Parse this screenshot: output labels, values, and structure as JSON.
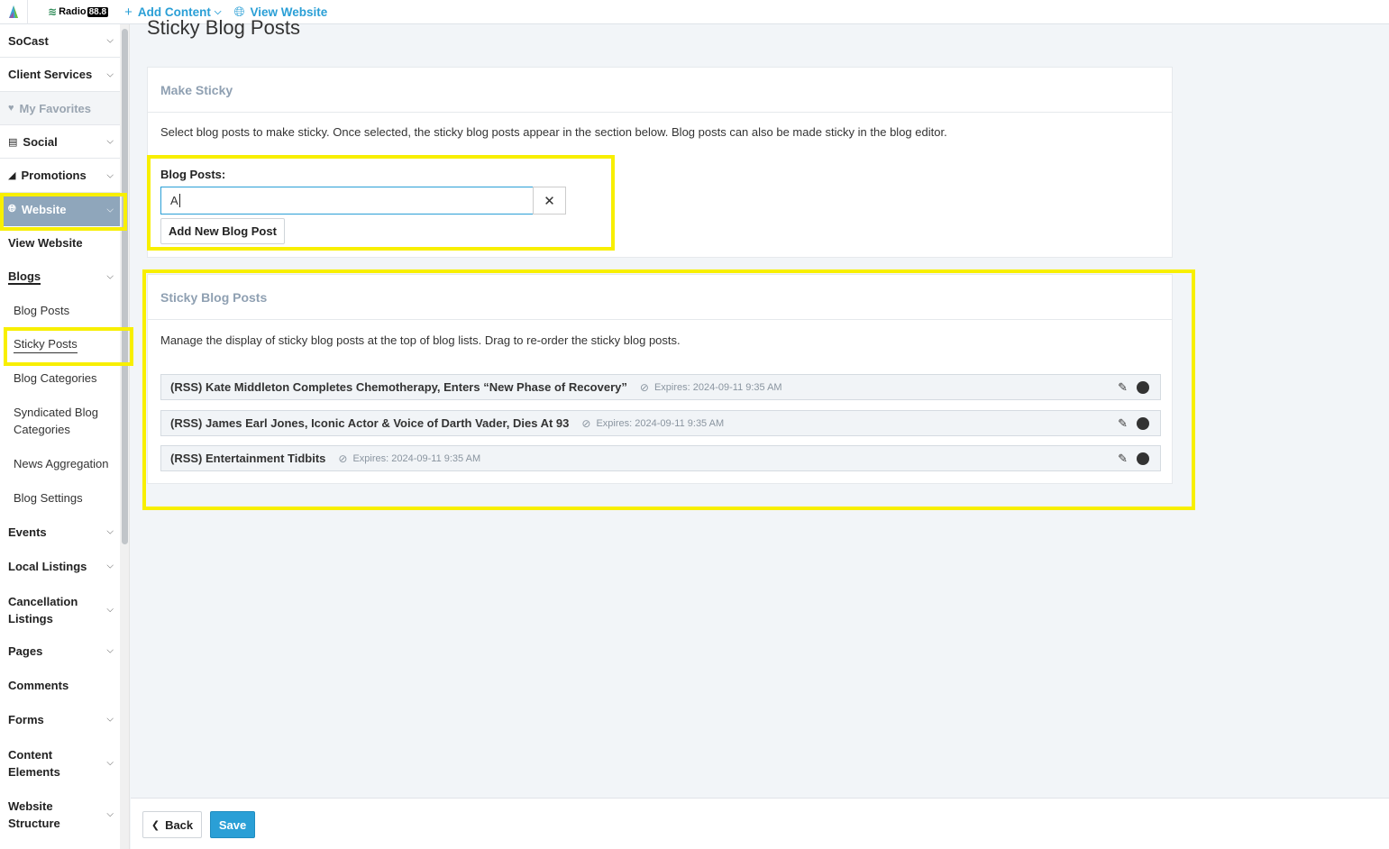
{
  "topbar": {
    "station_name": "Radio",
    "station_number": "88.8",
    "add_content": "Add Content",
    "view_website": "View Website"
  },
  "sidebar": {
    "socast": "SoCast",
    "client_services": "Client Services",
    "my_favorites": "My Favorites",
    "social": "Social",
    "promotions": "Promotions",
    "website": "Website",
    "view_website": "View Website",
    "blogs": "Blogs",
    "blog_posts": "Blog Posts",
    "sticky_posts": "Sticky Posts",
    "blog_categories": "Blog Categories",
    "syndicated_1": "Syndicated Blog",
    "syndicated_2": "Categories",
    "news_aggregation": "News Aggregation",
    "blog_settings": "Blog Settings",
    "events": "Events",
    "local_listings": "Local Listings",
    "cancellation_1": "Cancellation",
    "cancellation_2": "Listings",
    "pages": "Pages",
    "comments": "Comments",
    "forms": "Forms",
    "content_elements_1": "Content",
    "content_elements_2": "Elements",
    "website_structure_1": "Website",
    "website_structure_2": "Structure"
  },
  "page": {
    "title": "Sticky Blog Posts"
  },
  "make_sticky": {
    "heading": "Make Sticky",
    "description": "Select blog posts to make sticky. Once selected, the sticky blog posts appear in the section below. Blog posts can also be made sticky in the blog editor.",
    "blog_posts_label": "Blog Posts:",
    "search_value": "A",
    "add_new": "Add New Blog Post"
  },
  "sticky_section": {
    "heading": "Sticky Blog Posts",
    "description": "Manage the display of sticky blog posts at the top of blog lists. Drag to re-order the sticky blog posts.",
    "items": [
      {
        "title": "(RSS) Kate Middleton Completes Chemotherapy, Enters “New Phase of Recovery”",
        "expires": "Expires: 2024-09-11 9:35 AM"
      },
      {
        "title": "(RSS) James Earl Jones, Iconic Actor & Voice of Darth Vader, Dies At 93",
        "expires": "Expires: 2024-09-11 9:35 AM"
      },
      {
        "title": "(RSS) Entertainment Tidbits",
        "expires": "Expires: 2024-09-11 9:35 AM"
      }
    ]
  },
  "footer": {
    "back": "Back",
    "save": "Save"
  },
  "colors": {
    "accent": "#2a9fd6",
    "highlight": "#f8ef00",
    "sidebar_active": "#8fa6bb"
  }
}
